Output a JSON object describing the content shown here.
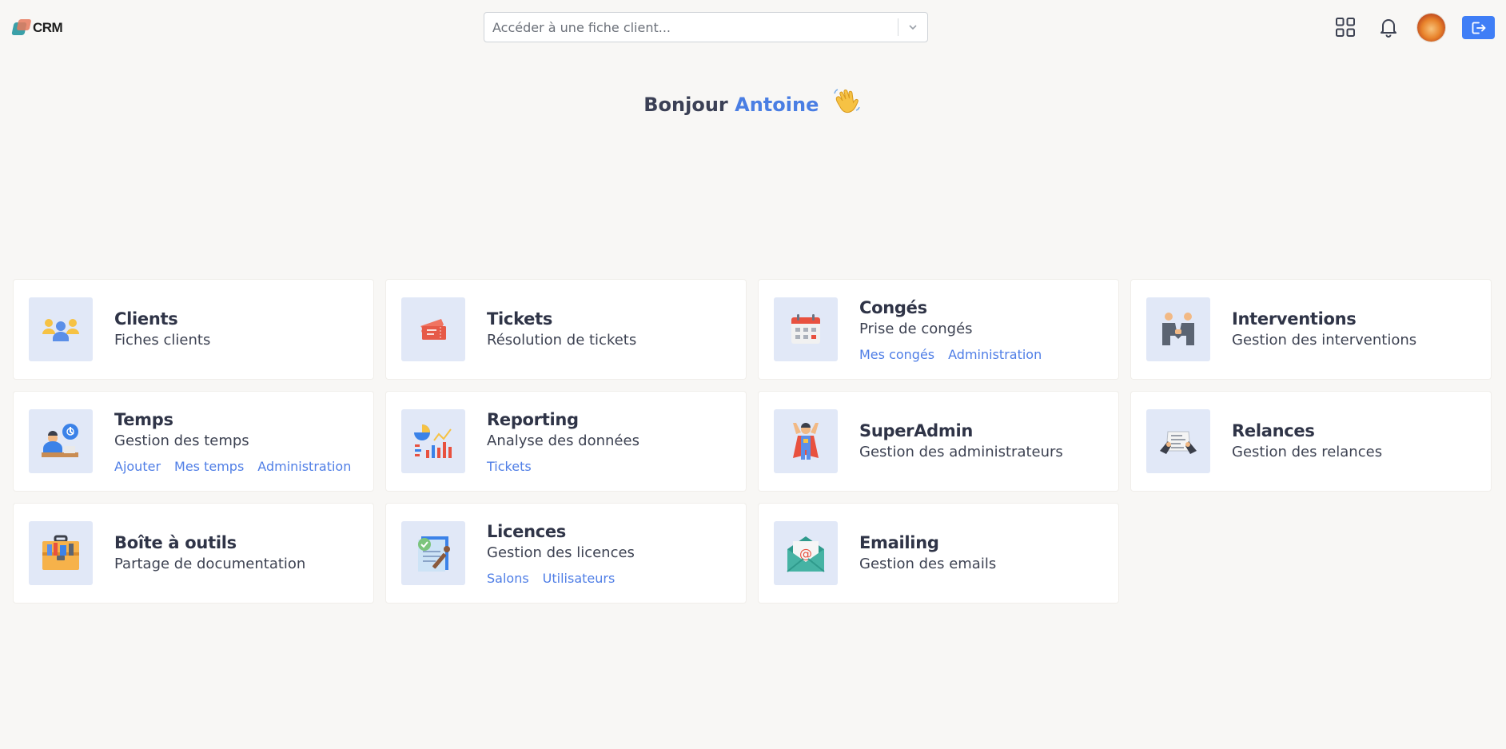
{
  "header": {
    "logo_text": "CRM",
    "search": {
      "placeholder": "Accéder à une fiche client..."
    }
  },
  "greeting": {
    "prefix": "Bonjour",
    "name": "Antoine"
  },
  "colors": {
    "accent": "#3f7ef6",
    "link": "#4f7ee6",
    "tile_bg": "#e1e8f7",
    "page_bg": "#f8f7f5"
  },
  "cards": [
    {
      "title": "Clients",
      "subtitle": "Fiches clients",
      "icon": "clients-icon",
      "links": []
    },
    {
      "title": "Tickets",
      "subtitle": "Résolution de tickets",
      "icon": "ticket-icon",
      "links": []
    },
    {
      "title": "Congés",
      "subtitle": "Prise de congés",
      "icon": "calendar-icon",
      "links": [
        "Mes congés",
        "Administration"
      ]
    },
    {
      "title": "Interventions",
      "subtitle": "Gestion des interventions",
      "icon": "handshake-icon",
      "links": []
    },
    {
      "title": "Temps",
      "subtitle": "Gestion des temps",
      "icon": "worker-clock-icon",
      "links": [
        "Ajouter",
        "Mes temps",
        "Administration"
      ]
    },
    {
      "title": "Reporting",
      "subtitle": "Analyse des données",
      "icon": "chart-icon",
      "links": [
        "Tickets"
      ]
    },
    {
      "title": "SuperAdmin",
      "subtitle": "Gestion des administrateurs",
      "icon": "superhero-icon",
      "links": []
    },
    {
      "title": "Relances",
      "subtitle": "Gestion des relances",
      "icon": "document-hands-icon",
      "links": []
    },
    {
      "title": "Boîte à outils",
      "subtitle": "Partage de documentation",
      "icon": "toolbox-icon",
      "links": []
    },
    {
      "title": "Licences",
      "subtitle": "Gestion des licences",
      "icon": "license-icon",
      "links": [
        "Salons",
        "Utilisateurs"
      ]
    },
    {
      "title": "Emailing",
      "subtitle": "Gestion des emails",
      "icon": "email-icon",
      "links": []
    }
  ]
}
